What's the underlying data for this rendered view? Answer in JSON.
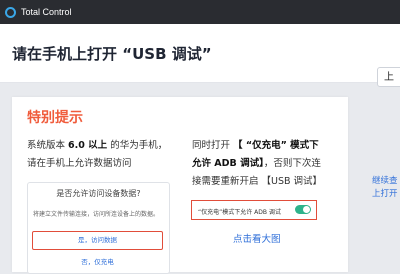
{
  "window": {
    "title": "Total Control"
  },
  "dialog": {
    "title": "请在手机上打开 “USB 调试”",
    "header_button": "上"
  },
  "tip": {
    "heading": "特别提示",
    "line1_a": "系统版本 ",
    "line1_b": "6.0 以上",
    "line1_c": " 的华为手机，",
    "line2": "请在手机上允许数据访问"
  },
  "phone_card": {
    "title": "是否允许访问设备数据?",
    "desc": "将建立文件传输连接，访问所连设备上的数据。",
    "allow": "是，访问数据",
    "deny": "否，仅充电"
  },
  "right": {
    "r1_a": "同时打开 ",
    "r1_b": "【 “仅充电” 模式下",
    "r2_a": "允许 ADB 调试】",
    "r2_b": "，否则下次连",
    "r3": "接需要重新开启 【USB 调试】",
    "toggle_label": "“仅充电”模式下允许 ADB 调试",
    "view_large": "点击看大图"
  },
  "side": {
    "link1": "继续查",
    "link2": "上打开"
  },
  "colors": {
    "accent": "#f05c3c",
    "link": "#2f6fd9",
    "toggle_on": "#2eb38b",
    "titlebar": "#2a2c31"
  }
}
